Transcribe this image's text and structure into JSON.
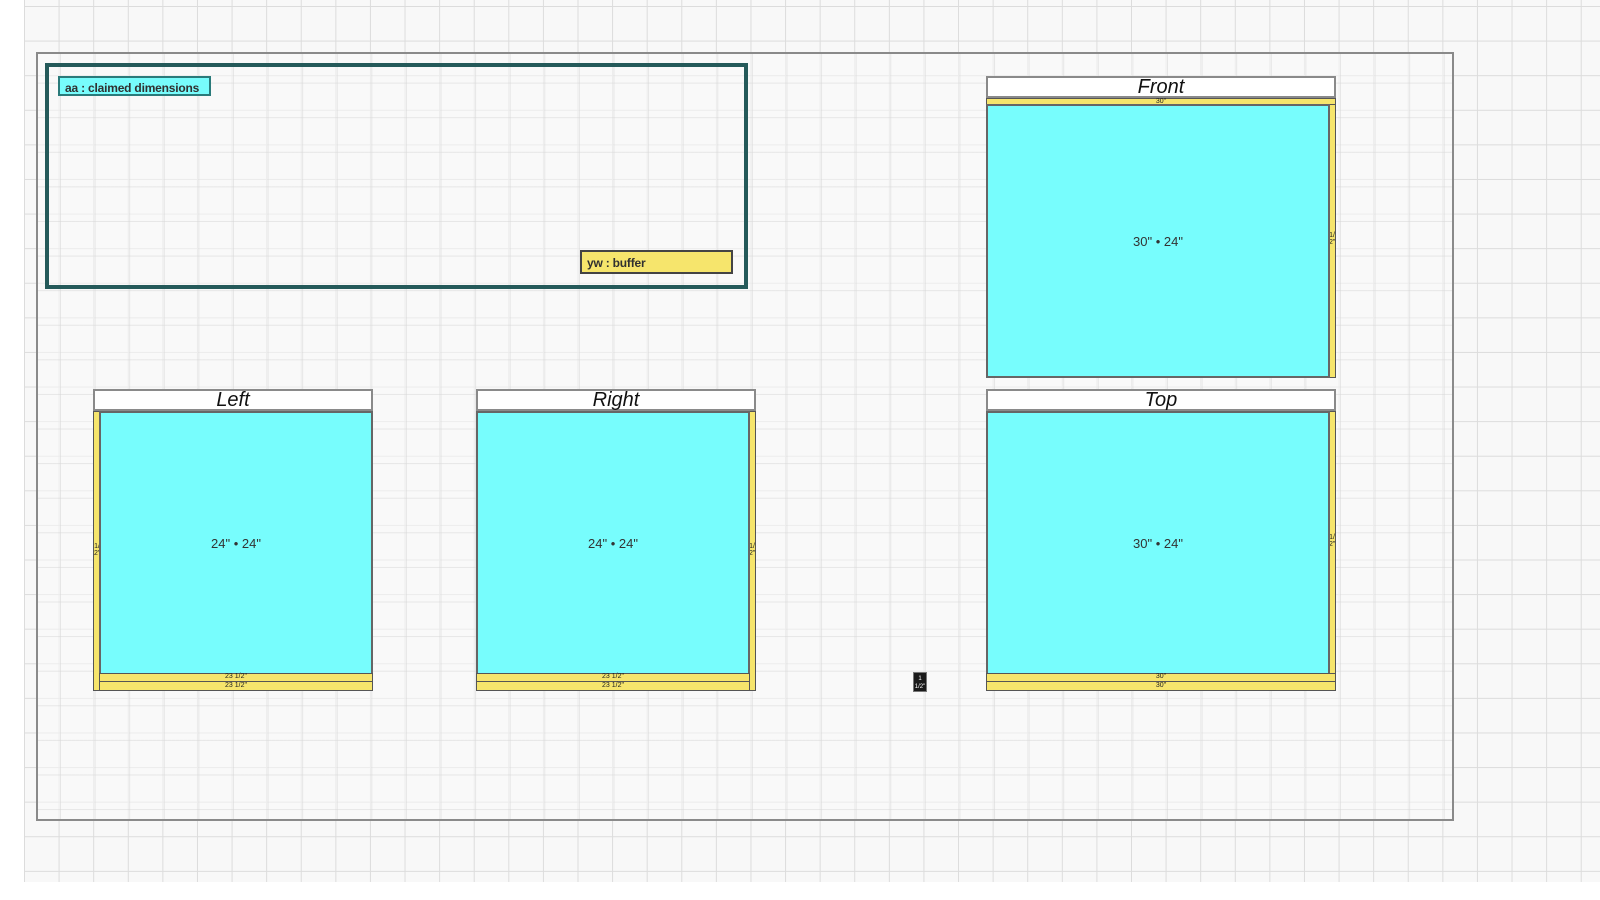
{
  "legend": {
    "claimed_label": "aa : claimed dimensions",
    "buffer_label": "yw : buffer"
  },
  "colors": {
    "claimed": "#77fdfd",
    "buffer": "#f6e56c",
    "legend_border": "#255a5a"
  },
  "views": {
    "front": {
      "title": "Front",
      "face_label": "30\" • 24\"",
      "top_dim": "30\"",
      "side_dim": "1/2\""
    },
    "top": {
      "title": "Top",
      "face_label": "30\" • 24\"",
      "bottom_dim_a": "30\"",
      "bottom_dim_b": "30\"",
      "side_dim": "1/2\""
    },
    "left": {
      "title": "Left",
      "face_label": "24\" • 24\"",
      "bottom_dim_a": "23 1/2\"",
      "bottom_dim_b": "23 1/2\"",
      "side_dim": "1/2\""
    },
    "right": {
      "title": "Right",
      "face_label": "24\" • 24\"",
      "bottom_dim_a": "23 1/2\"",
      "bottom_dim_b": "23 1/2\"",
      "side_dim": "1/2\""
    }
  },
  "marker": {
    "top": "1",
    "bottom": "1/2\""
  }
}
